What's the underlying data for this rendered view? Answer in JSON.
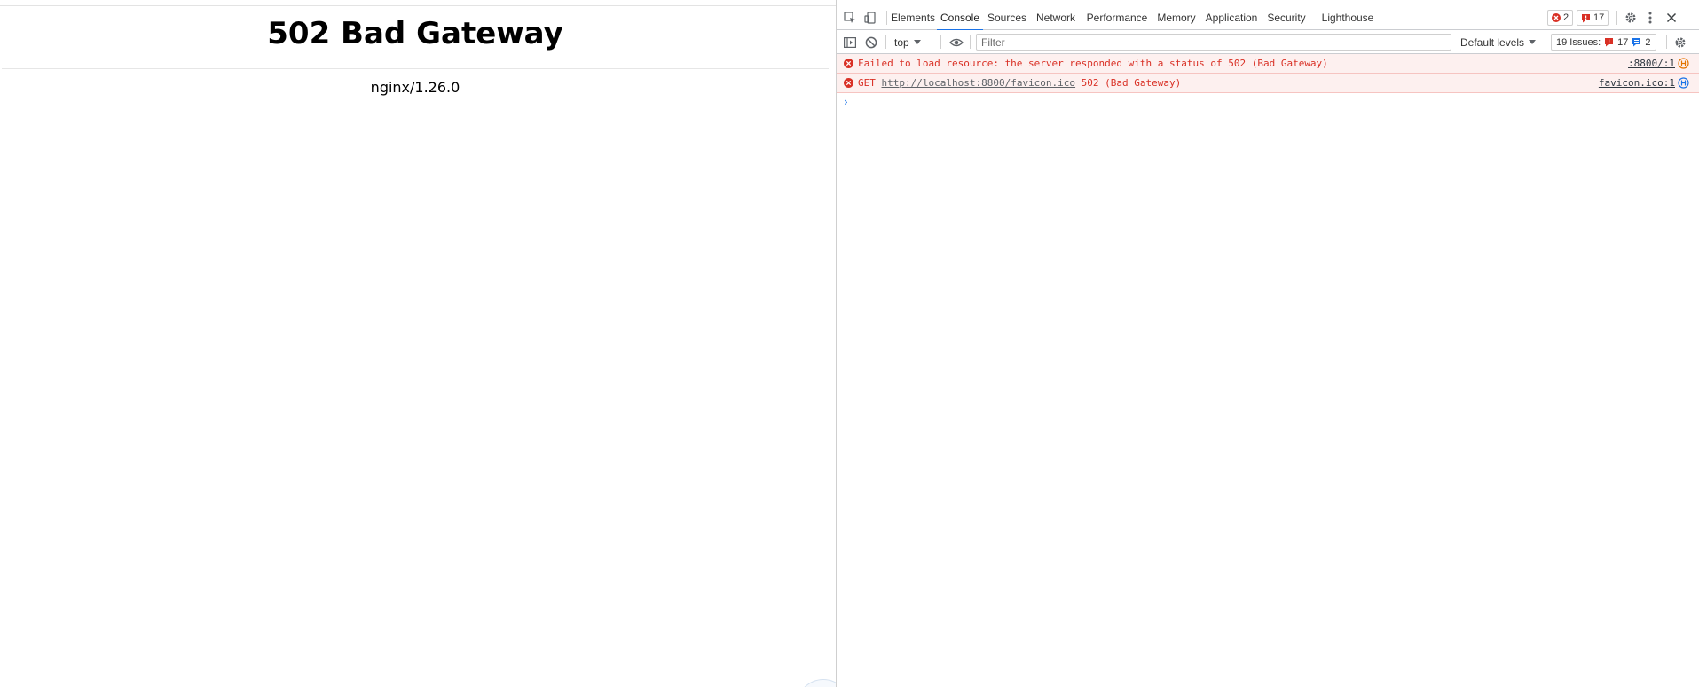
{
  "page": {
    "title": "502 Bad Gateway",
    "server": "nginx/1.26.0"
  },
  "devtools": {
    "tabs": [
      {
        "label": "Elements"
      },
      {
        "label": "Console"
      },
      {
        "label": "Sources"
      },
      {
        "label": "Network"
      },
      {
        "label": "Performance"
      },
      {
        "label": "Memory"
      },
      {
        "label": "Application"
      },
      {
        "label": "Security"
      },
      {
        "label": "Lighthouse"
      }
    ],
    "active_tab": "Console",
    "error_count": "2",
    "warning_count": "17",
    "toolbar": {
      "context": "top",
      "filter_placeholder": "Filter",
      "levels": "Default levels",
      "issues_label": "19 Issues:",
      "issues_warnings": "17",
      "issues_info": "2"
    },
    "messages": [
      {
        "text": "Failed to load resource: the server responded with a status of 502 (Bad Gateway)",
        "source": ":8800/:1"
      },
      {
        "method": "GET",
        "url": "http://localhost:8800/favicon.ico",
        "status": "502 (Bad Gateway)",
        "source": "favicon.ico:1"
      }
    ],
    "icons": {
      "inspect": "inspect-element-icon",
      "device": "device-toolbar-icon",
      "sidebar": "console-sidebar-icon",
      "clear": "clear-console-icon",
      "eye": "live-expression-icon",
      "settings": "settings-gear-icon",
      "more": "more-options-icon",
      "close": "close-icon"
    },
    "colors": {
      "error": "#d93025",
      "error_bg": "#fdf0ef",
      "accent": "#1a73e8",
      "warning": "#e37400"
    }
  }
}
